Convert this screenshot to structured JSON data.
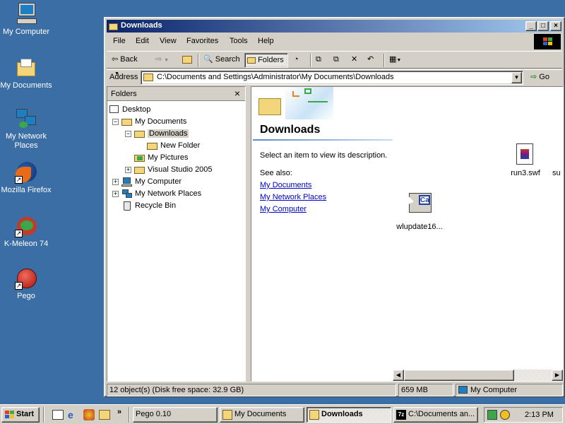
{
  "desktop_icons": [
    {
      "label": "My Computer",
      "icon": "computer-icon"
    },
    {
      "label": "My Documents",
      "icon": "folder-icon"
    },
    {
      "label": "My Network Places",
      "icon": "network-icon"
    },
    {
      "label": "Mozilla Firefox",
      "icon": "firefox-icon"
    },
    {
      "label": "K-Meleon 74",
      "icon": "kmeleon-icon"
    },
    {
      "label": "Pego",
      "icon": "pego-icon"
    }
  ],
  "window": {
    "title": "Downloads",
    "menu": [
      "File",
      "Edit",
      "View",
      "Favorites",
      "Tools",
      "Help"
    ],
    "toolbar": {
      "back": "Back",
      "search": "Search",
      "folders": "Folders"
    },
    "address": {
      "label": "Address",
      "value": "C:\\Documents and Settings\\Administrator\\My Documents\\Downloads",
      "go": "Go"
    },
    "folders_pane": {
      "title": "Folders",
      "tree": [
        {
          "label": "Desktop",
          "icon": "desktop-icon"
        },
        {
          "label": "My Documents",
          "icon": "folder-open-icon"
        },
        {
          "label": "Downloads",
          "icon": "folder-open-icon"
        },
        {
          "label": "New Folder",
          "icon": "folder-icon"
        },
        {
          "label": "My Pictures",
          "icon": "pictures-folder-icon"
        },
        {
          "label": "Visual Studio 2005",
          "icon": "folder-icon"
        },
        {
          "label": "My Computer",
          "icon": "computer-icon"
        },
        {
          "label": "My Network Places",
          "icon": "network-icon"
        },
        {
          "label": "Recycle Bin",
          "icon": "recycle-bin-icon"
        }
      ]
    },
    "content": {
      "heading": "Downloads",
      "description": "Select an item to view its description.",
      "see_also": "See also:",
      "links": [
        "My Documents",
        "My Network Places",
        "My Computer"
      ],
      "files": [
        {
          "name": "wlupdate16...",
          "icon": "ca-file-icon"
        },
        {
          "name": "run3.swf",
          "icon": "swf-file-icon"
        },
        {
          "name": "su",
          "icon": "file-icon"
        }
      ]
    },
    "status": {
      "objects": "12 object(s) (Disk free space: 32.9 GB)",
      "size": "659 MB",
      "zone": "My Computer"
    }
  },
  "taskbar": {
    "start": "Start",
    "tasks": [
      {
        "label": "Pego 0.10",
        "pressed": false
      },
      {
        "label": "My Documents",
        "pressed": false
      },
      {
        "label": "Downloads",
        "pressed": true
      },
      {
        "label": "C:\\Documents an...",
        "pressed": false
      }
    ],
    "clock": "2:13 PM"
  },
  "colors": {
    "desktop": "#3a6ea5",
    "title_active": "#0a246a",
    "face": "#d4d0c8",
    "link": "#0000cc"
  }
}
